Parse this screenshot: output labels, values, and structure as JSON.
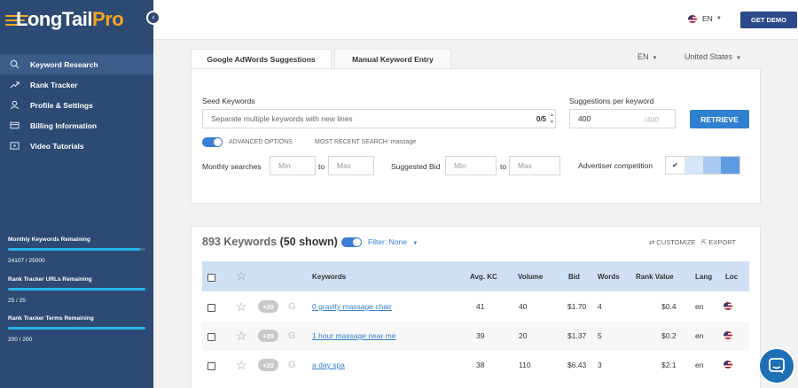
{
  "brand": {
    "name_main": "LongTail",
    "name_pro": "Pro"
  },
  "sidebar": {
    "collapse_icon": "‹",
    "items": [
      {
        "label": "Keyword Research",
        "icon": "search-icon",
        "active": true
      },
      {
        "label": "Rank Tracker",
        "icon": "trend-icon",
        "active": false
      },
      {
        "label": "Profile & Settings",
        "icon": "user-icon",
        "active": false
      },
      {
        "label": "Billing Information",
        "icon": "card-icon",
        "active": false
      },
      {
        "label": "Video Tutorials",
        "icon": "play-icon",
        "active": false
      }
    ],
    "quotas": [
      {
        "label": "Monthly Keywords Remaining",
        "value": "24107 / 25000",
        "fraction": 0.964
      },
      {
        "label": "Rank Tracker URLs Remaining",
        "value": "25 / 25",
        "fraction": 1.0
      },
      {
        "label": "Rank Tracker Terms Remaining",
        "value": "200 / 200",
        "fraction": 1.0
      }
    ]
  },
  "topbar": {
    "language": "EN",
    "demo_label": "GET DEMO"
  },
  "tabs": [
    {
      "label": "Google AdWords Suggestions",
      "active": true
    },
    {
      "label": "Manual Keyword Entry",
      "active": false
    }
  ],
  "selectors": {
    "language": "EN",
    "country": "United States"
  },
  "search": {
    "seed_label": "Seed Keywords",
    "seed_placeholder": "Separate multiple keywords with new lines",
    "seed_count": "0/5",
    "suggestions_label": "Suggestions per keyword",
    "suggestions_value": "400",
    "suggestions_max": "/400",
    "retrieve_label": "RETRIEVE",
    "advanced_label": "ADVANCED OPTIONS",
    "recent_label": "MOST RECENT SEARCH: massage",
    "monthly_label": "Monthly searches",
    "bid_label": "Suggested Bid",
    "min_placeholder": "Min",
    "max_placeholder": "Max",
    "to_label": "to",
    "competition_label": "Advertiser competition",
    "competition_check": "✔"
  },
  "results": {
    "count_text": "893 Keywords",
    "shown_text": "(50 shown)",
    "filter_label": "Filter:",
    "filter_value": "None",
    "customize_label": "CUSTOMIZE",
    "export_label": "EXPORT",
    "columns": {
      "keywords": "Keywords",
      "avg_kc": "Avg. KC",
      "volume": "Volume",
      "bid": "Bid",
      "words": "Words",
      "rank_value": "Rank Value",
      "lang": "Lang",
      "loc": "Loc"
    },
    "rows": [
      {
        "badge": "+20",
        "g": "G",
        "keyword": "0 gravity massage chair",
        "avg_kc": "41",
        "volume": "40",
        "bid": "$1.70",
        "words": "4",
        "rank_value": "$0.4",
        "lang": "en"
      },
      {
        "badge": "+20",
        "g": "G",
        "keyword": "1 hour massage near me",
        "avg_kc": "39",
        "volume": "20",
        "bid": "$1.37",
        "words": "5",
        "rank_value": "$0.2",
        "lang": "en"
      },
      {
        "badge": "+20",
        "g": "G",
        "keyword": "a day spa",
        "avg_kc": "38",
        "volume": "110",
        "bid": "$6.43",
        "words": "3",
        "rank_value": "$2.1",
        "lang": "en"
      }
    ]
  },
  "colors": {
    "sidebar": "#2c4a73",
    "accent": "#2f80d1",
    "brand_orange": "#f5a623",
    "quota_bar": "#28b4e6"
  }
}
